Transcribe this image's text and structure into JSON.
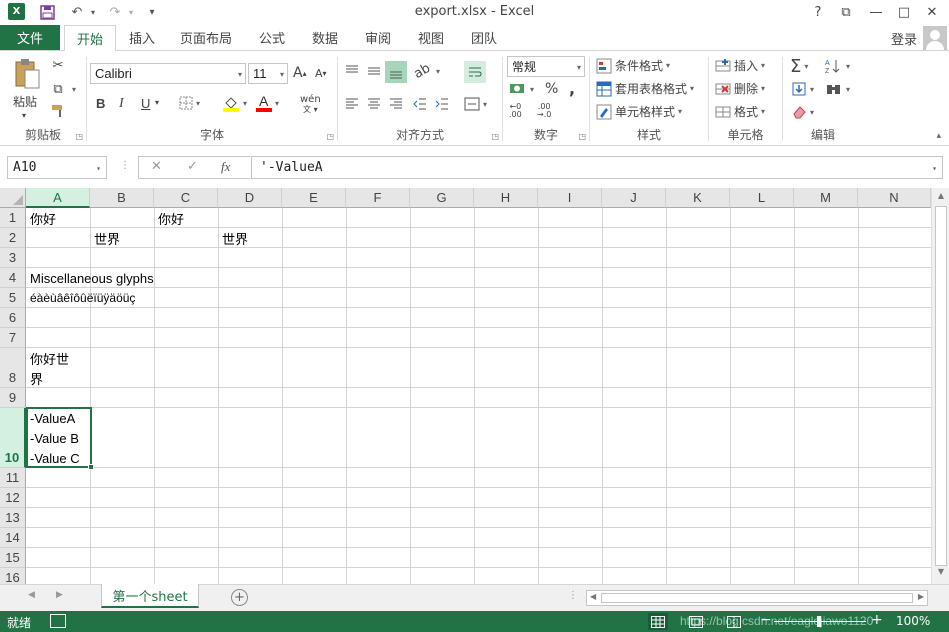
{
  "titlebar": {
    "title": "export.xlsx - Excel",
    "help": "?",
    "minimize": "—",
    "maximize": "□",
    "close": "✕",
    "restore_ribbon": "⧉",
    "undo": "↶",
    "redo": "↷",
    "quick_access_more": "▾"
  },
  "tabs": {
    "file": "文件",
    "items": [
      "开始",
      "插入",
      "页面布局",
      "公式",
      "数据",
      "审阅",
      "视图",
      "团队"
    ],
    "login": "登录"
  },
  "ribbon": {
    "clipboard": {
      "paste": "粘贴",
      "label": "剪贴板"
    },
    "font": {
      "name": "Calibri",
      "size": "11",
      "grow": "A",
      "shrink": "A",
      "bold": "B",
      "italic": "I",
      "underline": "U",
      "wen": "wén",
      "font_color_letter": "A",
      "label": "字体"
    },
    "alignment": {
      "label": "对齐方式"
    },
    "number": {
      "format": "常规",
      "percent": "%",
      "comma": ",",
      "label": "数字"
    },
    "styles": {
      "conditional": "条件格式",
      "table": "套用表格格式",
      "cell_styles": "单元格样式",
      "label": "样式"
    },
    "cells": {
      "insert": "插入",
      "delete": "删除",
      "format": "格式",
      "label": "单元格"
    },
    "editing": {
      "sum": "Σ",
      "label": "编辑"
    }
  },
  "formula_bar": {
    "name_box": "A10",
    "formula": "'-ValueA",
    "fx": "fx",
    "cancel": "✕",
    "enter": "✓"
  },
  "sheet": {
    "columns": [
      "A",
      "B",
      "C",
      "D",
      "E",
      "F",
      "G",
      "H",
      "I",
      "J",
      "K",
      "L",
      "M",
      "N"
    ],
    "rows": [
      "1",
      "2",
      "3",
      "4",
      "5",
      "6",
      "7",
      "8",
      "9",
      "10",
      "11",
      "12",
      "13",
      "14",
      "15",
      "16"
    ],
    "cells": {
      "A1": "你好",
      "C1": "你好",
      "B2": "世界",
      "D2": "世界",
      "A4": "Miscellaneous glyphs",
      "A5": "éàèùâêîôûëïüÿäöüç",
      "A8_line1": "你好世",
      "A8_line2": "界",
      "A10_line1": "-ValueA",
      "A10_line2": "-Value B",
      "A10_line3": "-Value C"
    },
    "selected_cell": "A10",
    "selected_column": "A",
    "selected_row": "10"
  },
  "sheet_tabs": {
    "items": [
      "第一个sheet"
    ],
    "add": "+"
  },
  "status": {
    "ready": "就绪",
    "zoom": "100%",
    "zoom_minus": "−",
    "zoom_plus": "+",
    "watermark": "https://blog.csdn.net/eaglejiawo1120"
  },
  "colors": {
    "accent": "#217346",
    "selection_header": "#d3f0e0"
  }
}
